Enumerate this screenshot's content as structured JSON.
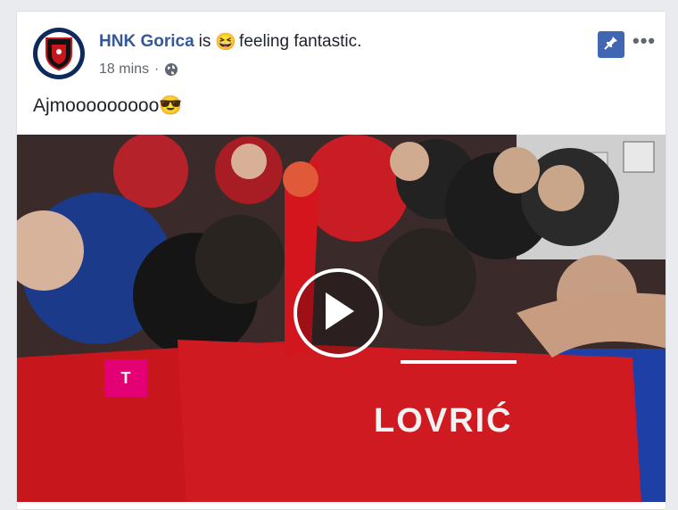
{
  "post": {
    "page_name": "HNK Gorica",
    "verb": "is",
    "feeling_emoji": "😆",
    "feeling_text": "feeling fantastic.",
    "timestamp": "18 mins",
    "separator": "·",
    "privacy_icon": "globe-icon",
    "text": "Ajmooooooooo😎"
  },
  "actions": {
    "pin_icon": "pin-icon",
    "more_label": "•••"
  },
  "video": {
    "play_icon": "play-icon",
    "jersey_text": "LOVRIĆ",
    "sponsor_mark": "T"
  },
  "colors": {
    "link": "#365899",
    "pin_bg": "#4267b2",
    "jersey_red": "#c8161d"
  }
}
